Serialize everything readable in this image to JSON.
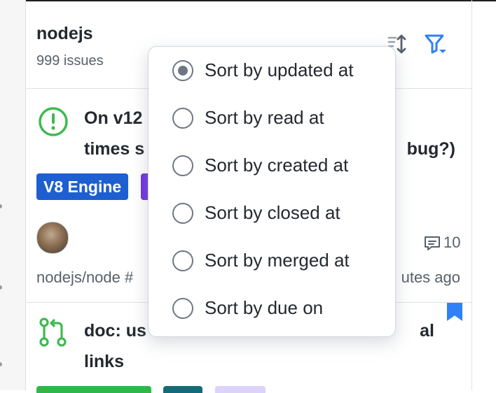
{
  "colors": {
    "accent": "#2f81f7",
    "open_issue": "#3fb950",
    "label_v8": "#1d5fd0",
    "label_purple": "#6c30e0"
  },
  "header": {
    "repo_name": "nodejs",
    "issue_count": "999 issues",
    "sort_icon": "sort-arrows-icon",
    "filter_icon": "filter-icon"
  },
  "items": [
    {
      "title_line1": "On v12",
      "title_line1_end": "",
      "title_line2_start": "times s",
      "title_line2_end": "bug?)",
      "labels": [
        "V8 Engine",
        ""
      ],
      "comments": "10",
      "repo_ref": "nodejs/node #",
      "time_fragment": "utes ago",
      "icon": "issue-opened-icon"
    },
    {
      "title_line1_start": "doc: us",
      "title_line1_end": "al",
      "title_line2": "links",
      "icon": "git-pull-request-icon",
      "bookmark_icon": "bookmark-icon"
    }
  ],
  "sort_menu": {
    "options": [
      {
        "label": "Sort by updated at",
        "selected": true
      },
      {
        "label": "Sort by read at",
        "selected": false
      },
      {
        "label": "Sort by created at",
        "selected": false
      },
      {
        "label": "Sort by closed at",
        "selected": false
      },
      {
        "label": "Sort by merged at",
        "selected": false
      },
      {
        "label": "Sort by due on",
        "selected": false
      }
    ]
  }
}
